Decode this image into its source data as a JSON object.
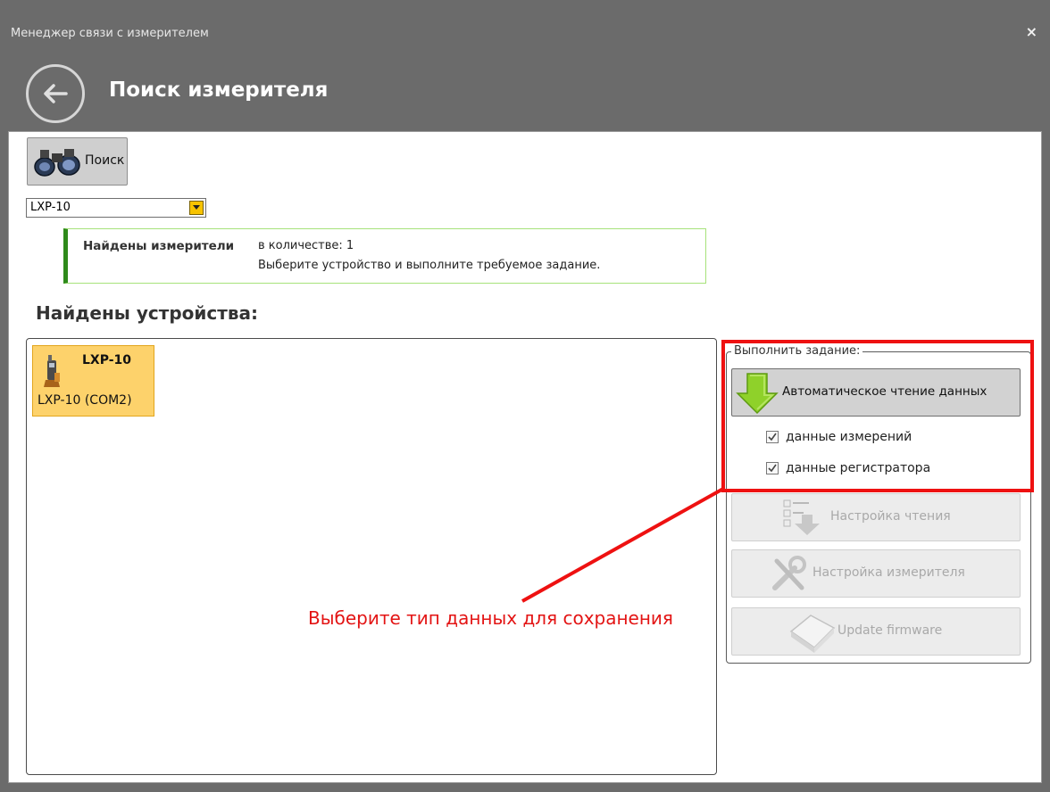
{
  "window": {
    "title": "Менеджер связи с измерителем",
    "close_glyph": "×"
  },
  "header": {
    "back_icon": "back-arrow-icon",
    "title": "Поиск измерителя"
  },
  "toolbar": {
    "search_label": "Поиск",
    "search_icon": "binoculars-icon"
  },
  "device_filter": {
    "selected": "LXP-10"
  },
  "info": {
    "heading": "Найдены измерители",
    "count_text": "в количестве: 1",
    "hint": "Выберите устройство и выполните требуемое задание."
  },
  "devices": {
    "heading": "Найдены устройства:",
    "items": [
      {
        "name": "LXP-10",
        "port": "LXP-10 (COM2)",
        "icon": "meter-device-icon"
      }
    ]
  },
  "task_panel": {
    "title": "Выполнить задание:",
    "auto_read_label": "Автоматическое чтение данных",
    "checkboxes": [
      {
        "label": "данные измерений",
        "checked": true
      },
      {
        "label": "данные регистратора",
        "checked": true
      }
    ],
    "read_settings_label": "Настройка чтения",
    "meter_settings_label": "Настройка измерителя",
    "firmware_label": "Update firmware"
  },
  "annotation": {
    "text": "Выберите тип данных для сохранения",
    "color": "#e31414"
  },
  "colors": {
    "window_bg": "#6b6b6b",
    "device_tile": "#fdd26b",
    "info_accent": "#2e8a1a",
    "highlight": "#ee1111"
  }
}
